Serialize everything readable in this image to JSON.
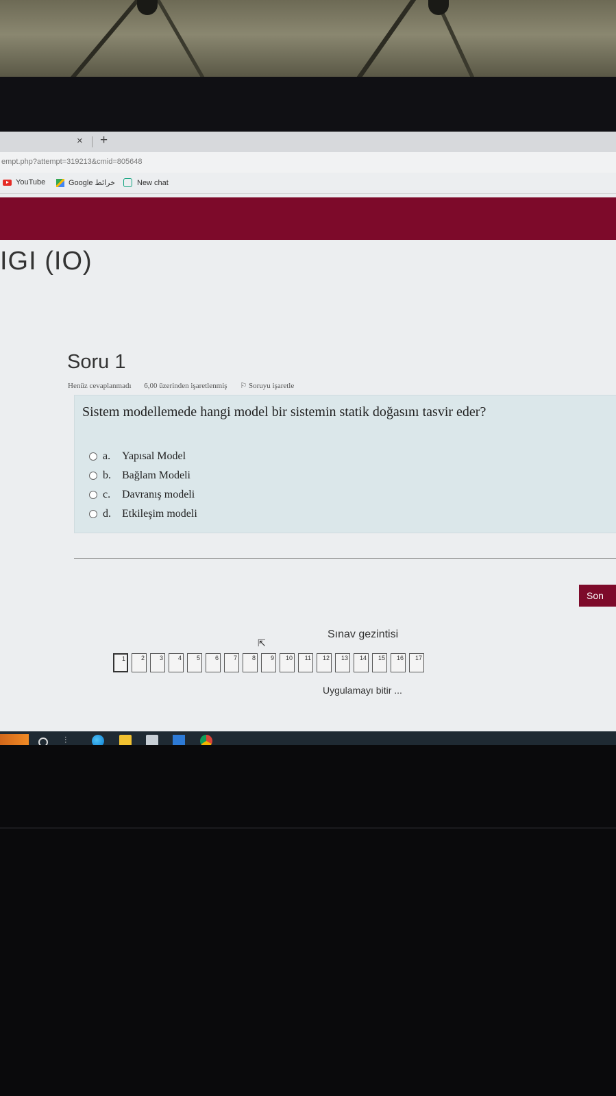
{
  "browser": {
    "tab_close": "×",
    "new_tab": "+",
    "url": "empt.php?attempt=319213&cmid=805648",
    "bookmarks": [
      {
        "label": "YouTube",
        "icon": "youtube-icon"
      },
      {
        "label": "Google خرائط",
        "icon": "google-maps-icon"
      },
      {
        "label": "New chat",
        "icon": "chatgpt-icon"
      }
    ]
  },
  "page": {
    "heading": "IGI (IO)"
  },
  "question": {
    "title": "Soru 1",
    "status": "Henüz cevaplanmadı",
    "marks": "6,00 üzerinden işaretlenmiş",
    "flag_label": "Soruyu işaretle",
    "text": "Sistem modellemede hangi model bir sistemin statik doğasını tasvir eder?",
    "answers": [
      {
        "letter": "a.",
        "label": "Yapısal Model"
      },
      {
        "letter": "b.",
        "label": "Bağlam Modeli"
      },
      {
        "letter": "c.",
        "label": "Davranış modeli"
      },
      {
        "letter": "d.",
        "label": "Etkileşim modeli"
      }
    ]
  },
  "next_button": "Son",
  "quiz_nav": {
    "title": "Sınav gezintisi",
    "buttons": [
      "1",
      "2",
      "3",
      "4",
      "5",
      "6",
      "7",
      "8",
      "9",
      "10",
      "11",
      "12",
      "13",
      "14",
      "15",
      "16",
      "17"
    ],
    "current": "1",
    "finish": "Uygulamayı bitir ..."
  },
  "colors": {
    "brand": "#7d0a2a",
    "question_box": "#dbe7ea"
  }
}
